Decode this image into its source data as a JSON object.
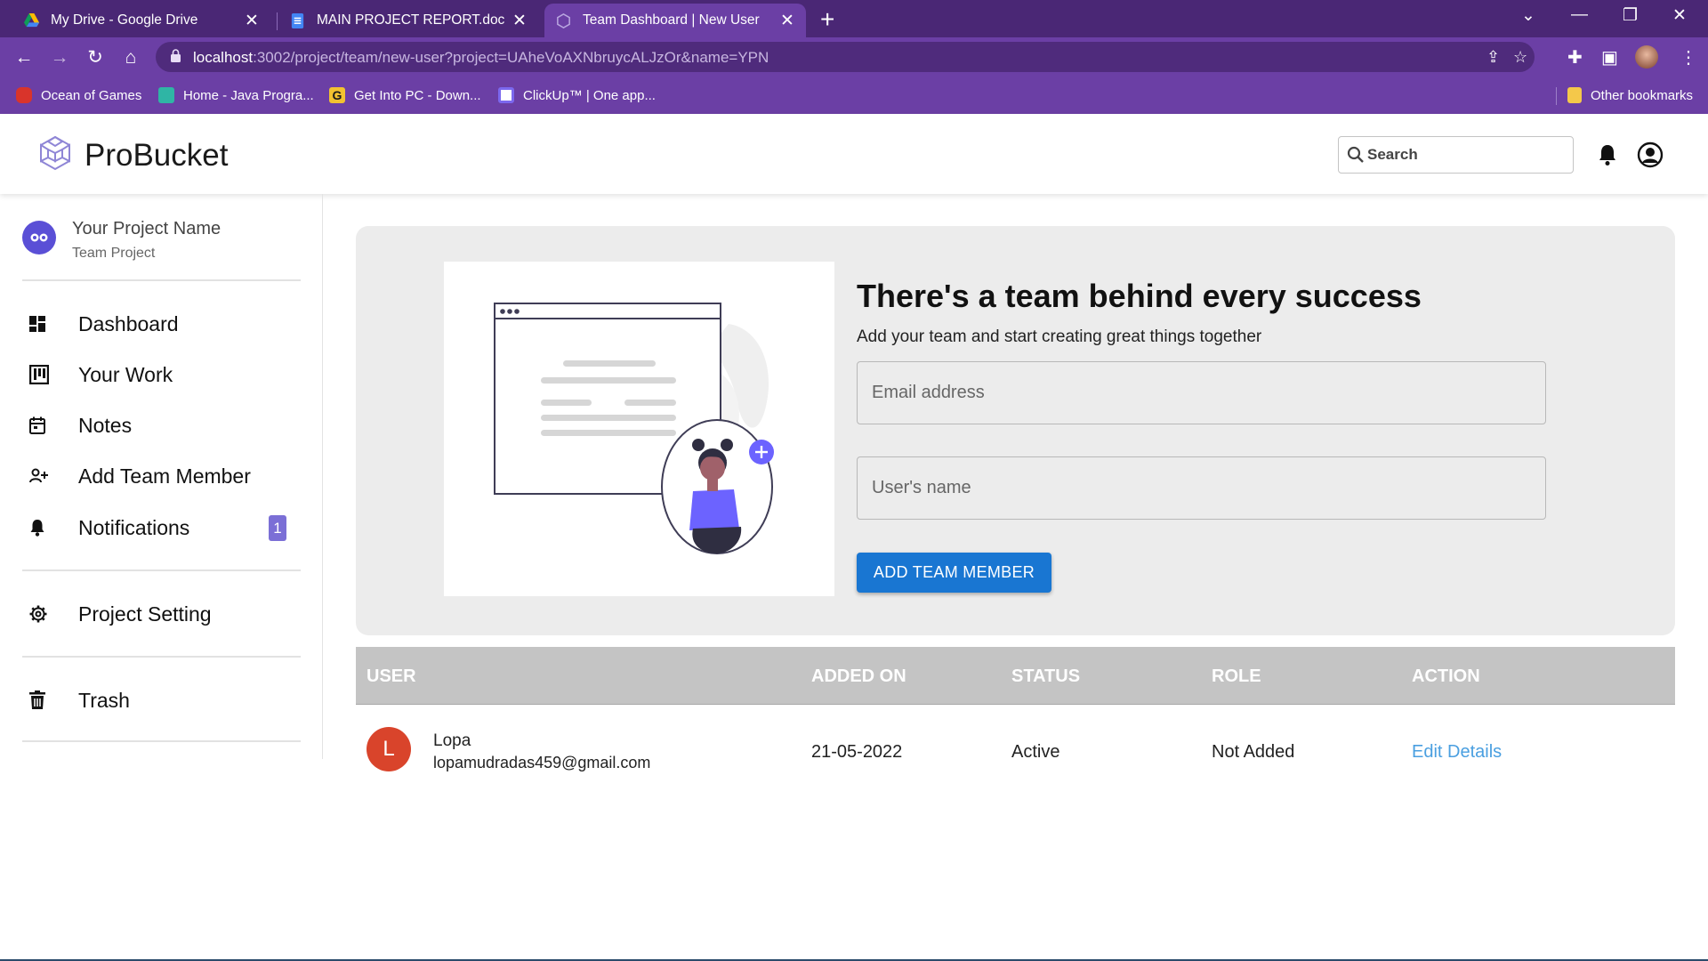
{
  "browser": {
    "tabs": [
      {
        "title": "My Drive - Google Drive"
      },
      {
        "title": "MAIN PROJECT REPORT.docx - Goo"
      },
      {
        "title": "Team Dashboard | New User"
      }
    ],
    "url_host": "localhost",
    "url_rest": ":3002/project/team/new-user?project=UAheVoAXNbruycALJzOr&name=YPN",
    "bookmarks": [
      {
        "label": "Ocean of Games",
        "color": "#d9342b"
      },
      {
        "label": "Home - Java Progra...",
        "color": "#2fb5a5"
      },
      {
        "label": "Get Into PC - Down...",
        "color": "#1a1a1a"
      },
      {
        "label": "ClickUp™ | One app...",
        "color": "#7b68ee"
      }
    ],
    "other_bookmarks": "Other bookmarks"
  },
  "header": {
    "brand": "ProBucket",
    "search_placeholder": "Search"
  },
  "sidebar": {
    "project_name": "Your Project Name",
    "project_type": "Team Project",
    "items": [
      {
        "label": "Dashboard",
        "icon": "dashboard-icon"
      },
      {
        "label": "Your Work",
        "icon": "kanban-icon"
      },
      {
        "label": "Notes",
        "icon": "calendar-icon"
      },
      {
        "label": "Add Team Member",
        "icon": "person-add-icon"
      },
      {
        "label": "Notifications",
        "icon": "bell-icon",
        "badge": "1"
      },
      {
        "label": "Project Setting",
        "icon": "gear-icon"
      },
      {
        "label": "Trash",
        "icon": "trash-icon"
      }
    ]
  },
  "invite": {
    "headline": "There's a team behind every success",
    "subline": "Add your team and start creating great things together",
    "email_placeholder": "Email address",
    "name_placeholder": "User's name",
    "button": "ADD TEAM MEMBER"
  },
  "table": {
    "headers": [
      "USER",
      "ADDED ON",
      "STATUS",
      "ROLE",
      "ACTION"
    ],
    "rows": [
      {
        "initial": "L",
        "name": "Lopa",
        "email": "lopamudradas459@gmail.com",
        "added_on": "21-05-2022",
        "status": "Active",
        "role": "Not Added",
        "action": "Edit Details"
      }
    ]
  },
  "colors": {
    "accent": "#1976d2",
    "browser_frame": "#6b3fa5",
    "avatar": "#d9442b",
    "link": "#4a9fe0"
  }
}
